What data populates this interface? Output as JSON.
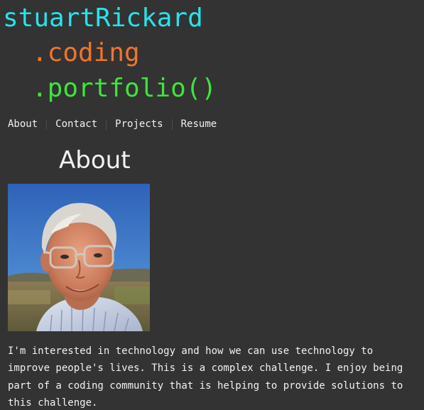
{
  "header": {
    "name": "stuartRickard",
    "line2": ".coding",
    "line3": ".portfolio()"
  },
  "nav": {
    "items": [
      "About",
      "Contact",
      "Projects",
      "Resume"
    ]
  },
  "main": {
    "section_title": "About",
    "bio_lines": [
      "I'm interested in technology and how we can use technology to",
      "improve people's lives. This is a complex challenge. I enjoy being",
      "part of a coding community that is helping to provide solutions to",
      "this challenge."
    ]
  },
  "colors": {
    "background": "#333333",
    "name": "#27e3ec",
    "coding": "#f0752a",
    "portfolio": "#3ee53a",
    "text": "#f2f2f2"
  }
}
